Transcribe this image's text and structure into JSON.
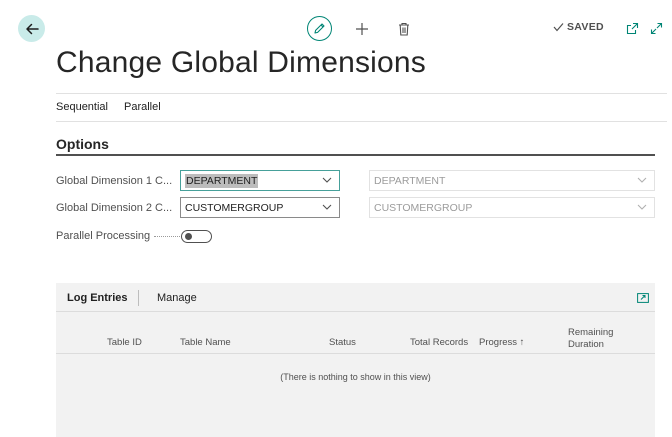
{
  "toolbar": {
    "saved_label": "SAVED"
  },
  "page": {
    "title": "Change Global Dimensions"
  },
  "actions": [
    "Sequential",
    "Parallel"
  ],
  "options": {
    "section_title": "Options",
    "global_dim_1": {
      "label": "Global Dimension 1 C...",
      "value": "DEPARTMENT",
      "current_value": "DEPARTMENT"
    },
    "global_dim_2": {
      "label": "Global Dimension 2 C...",
      "value": "CUSTOMERGROUP",
      "current_value": "CUSTOMERGROUP"
    },
    "parallel_processing": {
      "label": "Parallel Processing",
      "enabled": false
    }
  },
  "log": {
    "tabs": [
      "Log Entries",
      "Manage"
    ],
    "columns": [
      "Table ID",
      "Table Name",
      "Status",
      "Total Records",
      "Progress ↑",
      "Remaining",
      "Duration"
    ],
    "empty_message": "(There is nothing to show in this view)"
  },
  "colors": {
    "accent": "#008575",
    "back_button_bg": "#c9ebe9",
    "panel_bg": "#f2f2f2"
  },
  "icons": [
    "back-arrow-icon",
    "edit-pencil-icon",
    "plus-icon",
    "trash-icon",
    "checkmark-icon",
    "popout-icon",
    "expand-icon",
    "chevron-down-icon",
    "panel-expand-icon"
  ]
}
